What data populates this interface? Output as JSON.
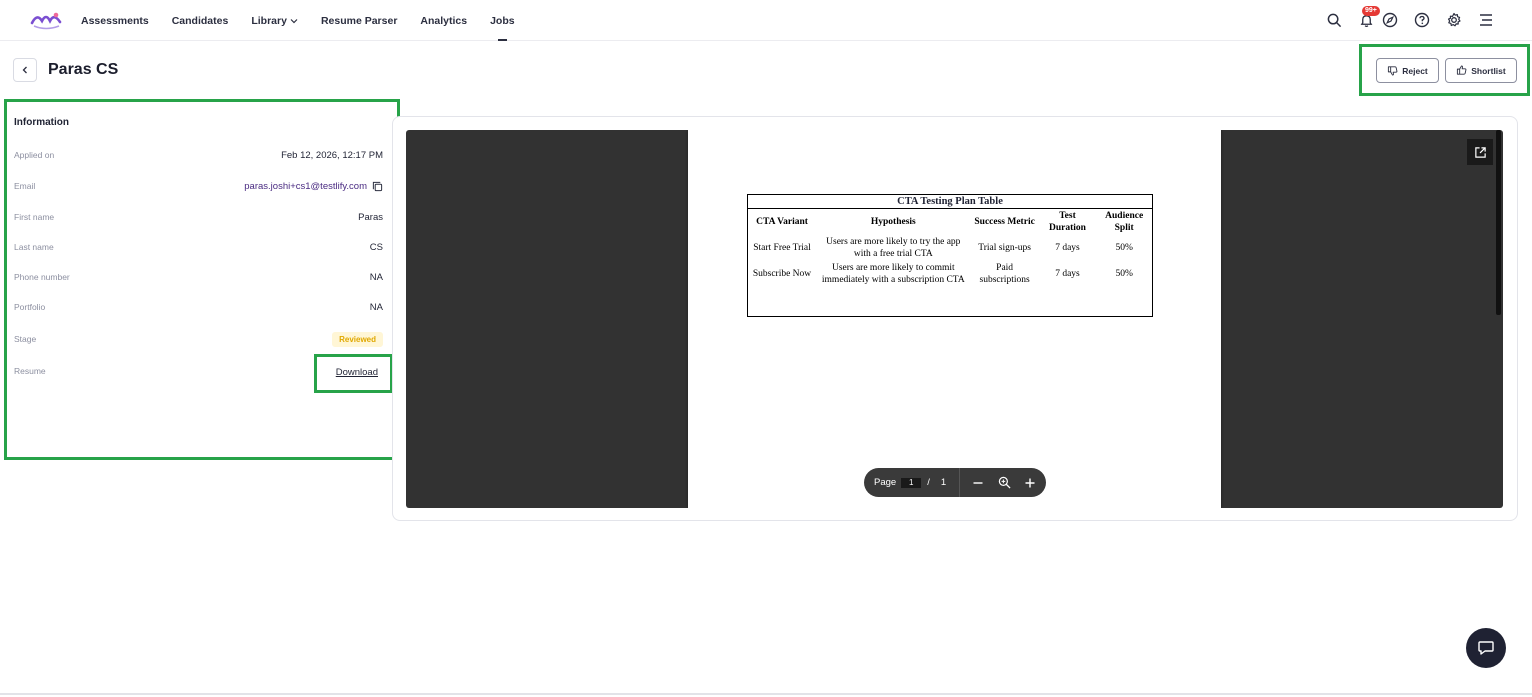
{
  "nav": {
    "items": [
      {
        "label": "Assessments"
      },
      {
        "label": "Candidates"
      },
      {
        "label": "Library"
      },
      {
        "label": "Resume Parser"
      },
      {
        "label": "Analytics"
      },
      {
        "label": "Jobs"
      }
    ],
    "notification_badge": "99+",
    "icons": [
      "search-icon",
      "bell-icon",
      "compass-icon",
      "help-circle-icon",
      "gear-icon",
      "menu-icon"
    ]
  },
  "header": {
    "title": "Paras CS",
    "reject_label": "Reject",
    "shortlist_label": "Shortlist"
  },
  "info": {
    "heading": "Information",
    "applied_on": {
      "label": "Applied on",
      "value": "Feb 12, 2026, 12:17 PM"
    },
    "email": {
      "label": "Email",
      "value": "paras.joshi+cs1@testlify.com"
    },
    "first_name": {
      "label": "First name",
      "value": "Paras"
    },
    "last_name": {
      "label": "Last name",
      "value": "CS"
    },
    "phone": {
      "label": "Phone number",
      "value": "NA"
    },
    "portfolio": {
      "label": "Portfolio",
      "value": "NA"
    },
    "stage": {
      "label": "Stage",
      "value": "Reviewed"
    },
    "resume": {
      "label": "Resume",
      "value": "Download"
    }
  },
  "document": {
    "table_title": "CTA Testing Plan Table",
    "columns": [
      "CTA Variant",
      "Hypothesis",
      "Success Metric",
      "Test Duration",
      "Audience Split"
    ],
    "rows": [
      [
        "Start Free Trial",
        "Users are more likely to try the app with a free trial CTA",
        "Trial sign-ups",
        "7 days",
        "50%"
      ],
      [
        "Subscribe Now",
        "Users are more likely to commit immediately with a subscription CTA",
        "Paid subscriptions",
        "7 days",
        "50%"
      ]
    ]
  },
  "pager": {
    "label": "Page",
    "current": "1",
    "separator": "/",
    "total": "1"
  },
  "colors": {
    "highlight": "#27a349",
    "stage_bg": "#fff6d6",
    "stage_text": "#e0a800",
    "viewer_bg": "#323232"
  }
}
